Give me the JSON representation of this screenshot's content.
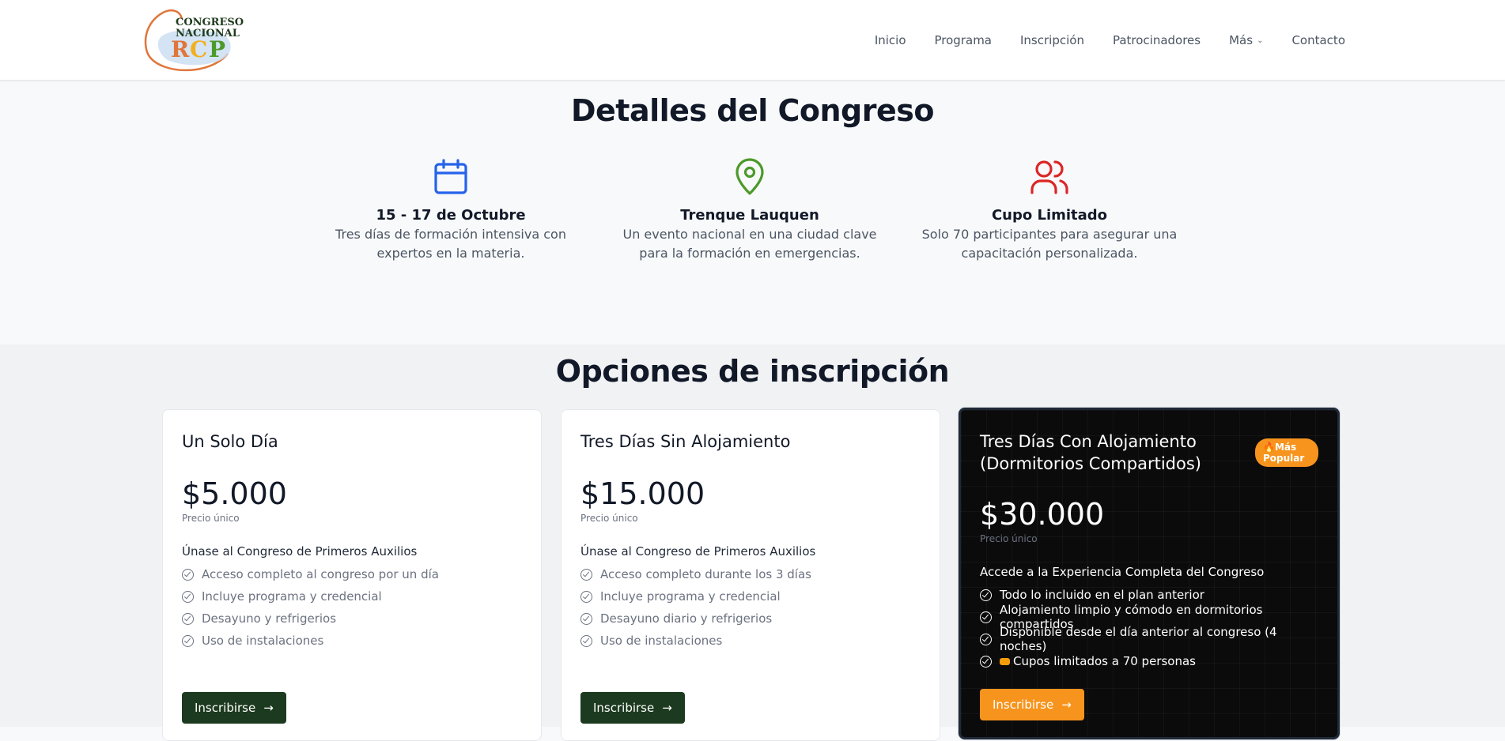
{
  "header": {
    "logo": {
      "line1": "CONGRESO",
      "line2": "NACIONAL",
      "letters": "RCP"
    },
    "nav": [
      {
        "label": "Inicio"
      },
      {
        "label": "Programa"
      },
      {
        "label": "Inscripción"
      },
      {
        "label": "Patrocinadores"
      },
      {
        "label": "Más"
      },
      {
        "label": "Contacto"
      }
    ]
  },
  "details": {
    "title": "Detalles del Congreso",
    "items": [
      {
        "icon": "calendar-icon",
        "color": "#2563eb",
        "title": "15 - 17 de Octubre",
        "line1": "Tres días de formación intensiva con",
        "line2": "expertos en la materia."
      },
      {
        "icon": "map-pin-icon",
        "color": "#4c9a2a",
        "title": "Trenque Lauquen",
        "line1": "Un evento nacional en una ciudad clave",
        "line2": "para la formación en emergencias."
      },
      {
        "icon": "users-icon",
        "color": "#dc2626",
        "title": "Cupo Limitado",
        "line1": "Solo 70 participantes para asegurar una",
        "line2": "capacitación personalizada."
      }
    ]
  },
  "plans": {
    "title": "Opciones de inscripción",
    "cards": [
      {
        "name": "Un Solo Día",
        "price": "$5.000",
        "note": "Precio único",
        "intro": "Únase al Congreso de Primeros Auxilios",
        "features": [
          "Acceso completo al congreso por un día",
          "Incluye programa y credencial",
          "Desayuno y refrigerios",
          "Uso de instalaciones"
        ],
        "button": "Inscribirse"
      },
      {
        "name": "Tres Días Sin Alojamiento",
        "price": "$15.000",
        "note": "Precio único",
        "intro": "Únase al Congreso de Primeros Auxilios",
        "features": [
          "Acceso completo durante los 3 días",
          "Incluye programa y credencial",
          "Desayuno diario y refrigerios",
          "Uso de instalaciones"
        ],
        "button": "Inscribirse"
      },
      {
        "name": "Tres Días Con Alojamiento (Dormitorios Compartidos)",
        "badge": "Más Popular",
        "price": "$30.000",
        "note": "Precio único",
        "intro": "Accede a la Experiencia Completa del Congreso",
        "features": [
          "Todo lo incluido en el plan anterior",
          "Alojamiento limpio y cómodo en dormitorios compartidos",
          "Disponible desde el día anterior al congreso (4 noches)",
          "Cupos limitados a 70 personas"
        ],
        "button": "Inscribirse"
      }
    ]
  },
  "colors": {
    "dark_green": "#1c3a1f",
    "orange": "#f7941d"
  }
}
